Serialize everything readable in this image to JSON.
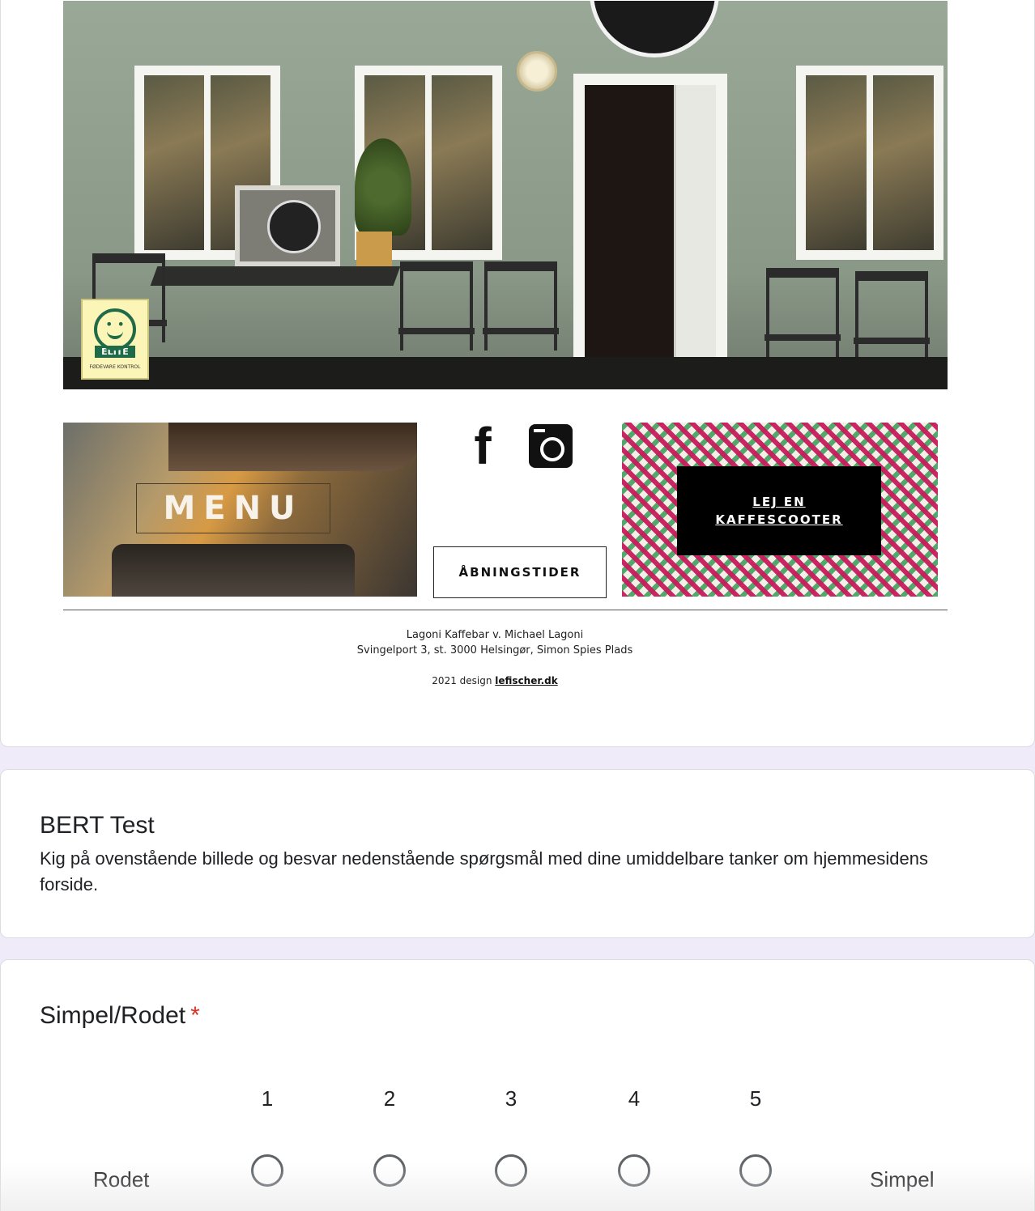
{
  "embed": {
    "elite_badge": {
      "label": "ELITE",
      "footer": "FØDEVARE KONTROL"
    },
    "menu_label": "MENU",
    "hours_button": "ÅBNINGSTIDER",
    "scooter_button": {
      "line1": "LEJ EN",
      "line2": "KAFFESCOOTER"
    },
    "social": {
      "facebook_icon": "facebook-icon",
      "instagram_icon": "instagram-icon"
    },
    "footer": {
      "line1": "Lagoni Kaffebar v. Michael Lagoni",
      "line2": "Svingelport 3, st. 3000 Helsingør, Simon Spies Plads",
      "credit_prefix": "2021 design ",
      "credit_link": "lefischer.dk"
    }
  },
  "section": {
    "title": "BERT Test",
    "description": "Kig på ovenstående billede og besvar nedenstående spørgsmål med dine umiddelbare tanker om hjemmesidens forside."
  },
  "question": {
    "title": "Simpel/Rodet",
    "required_mark": "*",
    "scale": [
      "1",
      "2",
      "3",
      "4",
      "5"
    ],
    "low_label": "Rodet",
    "high_label": "Simpel"
  },
  "colors": {
    "page_background": "#f0ebf8",
    "required": "#d93025",
    "elite_green": "#1f6b47"
  }
}
